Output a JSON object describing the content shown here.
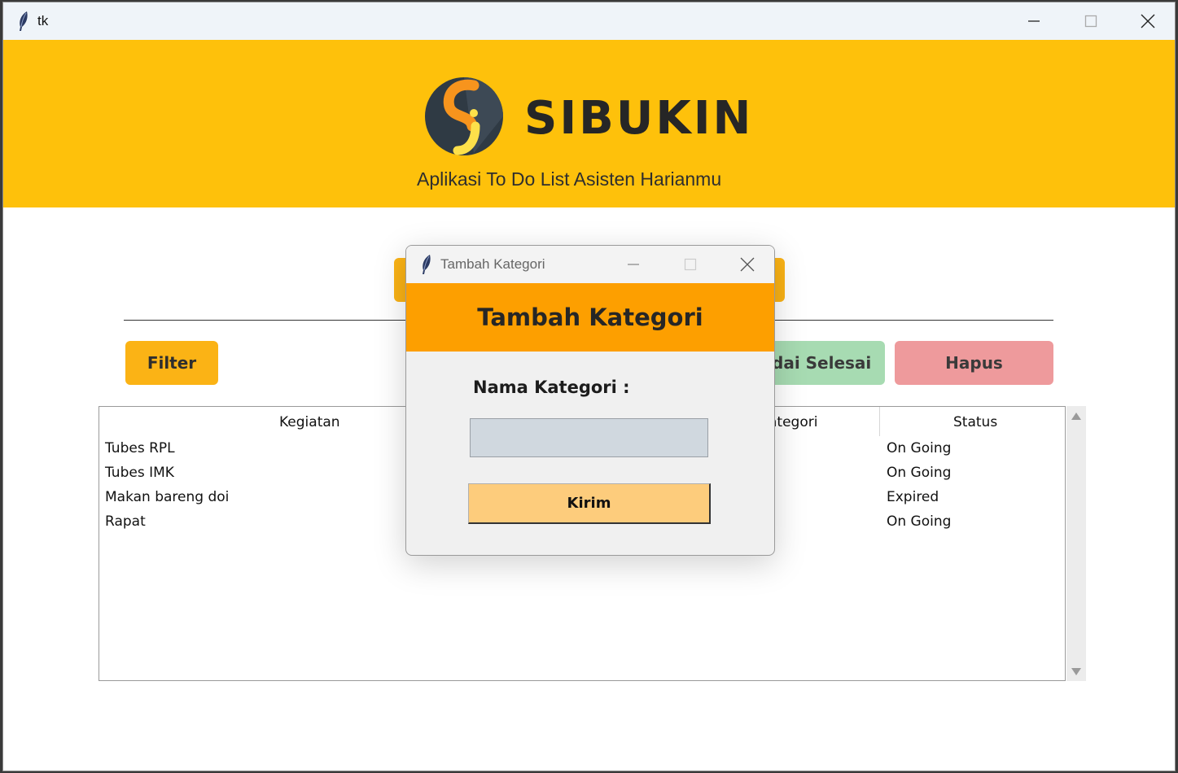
{
  "window": {
    "title": "tk"
  },
  "header": {
    "brand": "SIBUKIN",
    "tagline": "Aplikasi To Do List Asisten Harianmu",
    "bg_color": "#fec10b"
  },
  "toolbar": {
    "filter_label": "Filter",
    "mark_done_label": "dai Selesai",
    "delete_label": "Hapus"
  },
  "table": {
    "columns": [
      "Kegiatan",
      "ategori",
      "Status"
    ],
    "rows": [
      {
        "kegiatan": "Tubes RPL",
        "status": "On Going"
      },
      {
        "kegiatan": "Tubes IMK",
        "status": "On Going"
      },
      {
        "kegiatan": "Makan bareng doi",
        "status": "Expired"
      },
      {
        "kegiatan": "Rapat",
        "status": "On Going"
      }
    ]
  },
  "dialog": {
    "title": "Tambah Kategori",
    "heading": "Tambah Kategori",
    "field_label": "Nama Kategori :",
    "field_value": "",
    "submit_label": "Kirim",
    "accent_color": "#fd9f00"
  }
}
